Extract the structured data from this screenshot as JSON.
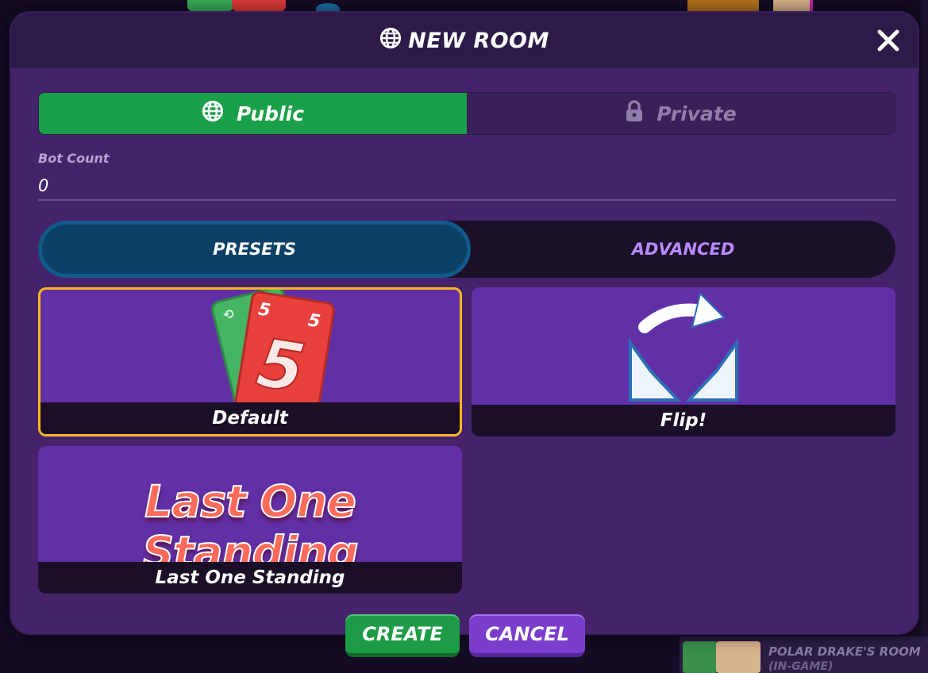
{
  "background": {
    "room_name": "POLAR DRAKE'S ROOM",
    "room_status": "(IN-GAME)"
  },
  "modal": {
    "title": "NEW ROOM",
    "title_icon": "globe-icon",
    "close_icon": "close-icon"
  },
  "privacy": {
    "public_label": "Public",
    "public_icon": "globe-icon",
    "private_label": "Private",
    "private_icon": "lock-icon",
    "selected": "Public"
  },
  "bot_count": {
    "label": "Bot Count",
    "value": "0"
  },
  "tabs": {
    "presets": "PRESETS",
    "advanced": "ADVANCED",
    "selected": "PRESETS"
  },
  "presets": [
    {
      "label": "Default",
      "selected": true
    },
    {
      "label": "Flip!",
      "selected": false
    },
    {
      "label": "Last One Standing",
      "art_text": "Last One Standing",
      "selected": false
    }
  ],
  "buttons": {
    "create": "CREATE",
    "cancel": "CANCEL"
  },
  "colors": {
    "modal_bg": "#45236b",
    "public_green": "#1aa04a",
    "selected_border": "#f8b81c",
    "presets_tab": "#0c4166",
    "advanced_text": "#b889ff",
    "create_green": "#1e9b47",
    "cancel_purple": "#7a3dcc"
  }
}
